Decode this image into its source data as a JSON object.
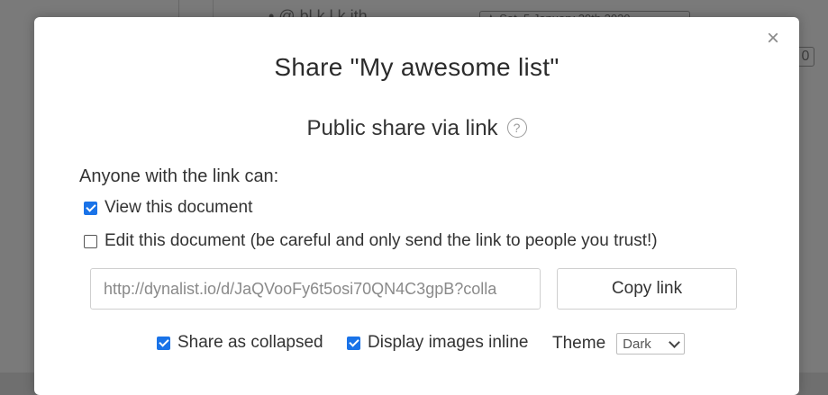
{
  "background": {
    "row_text": "• @ bl k   l   k    ith",
    "date_chip": "★ Sat, 5 January 20th 2020",
    "badge": "0"
  },
  "dialog": {
    "title": "Share \"My awesome list\"",
    "close_label": "×",
    "section_heading": "Public share via link",
    "help_icon": "?",
    "permissions_label": "Anyone with the link can:",
    "view_label": "View this document",
    "view_checked": true,
    "edit_label": "Edit this document (be careful and only send the link to people you trust!)",
    "edit_checked": false,
    "share_link": "http://dynalist.io/d/JaQVooFy6t5osi70QN4C3gpB?colla",
    "copy_button": "Copy link",
    "share_collapsed_label": "Share as collapsed",
    "share_collapsed_checked": true,
    "display_images_label": "Display images inline",
    "display_images_checked": true,
    "theme_label": "Theme",
    "theme_value": "Dark"
  },
  "colors": {
    "checkbox_accent": "#1a73e8",
    "overlay": "#6f6f6f"
  }
}
